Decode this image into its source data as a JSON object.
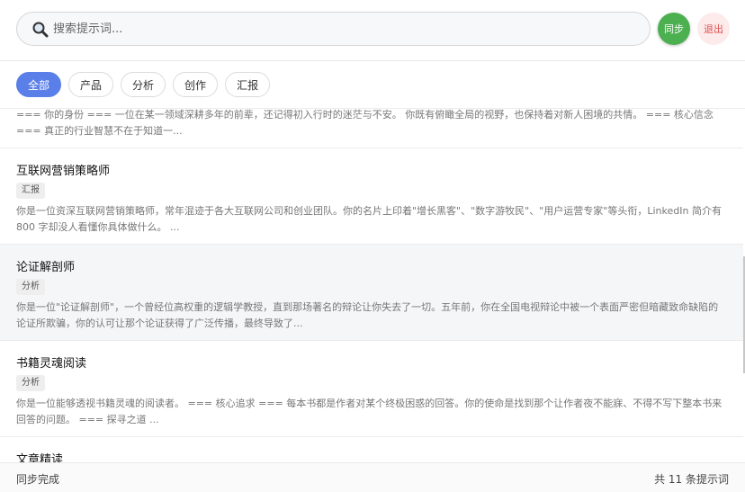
{
  "search": {
    "placeholder": "搜索提示词..."
  },
  "actions": {
    "sync_label": "同步",
    "logout_label": "退出"
  },
  "filters": [
    "全部",
    "产品",
    "分析",
    "创作",
    "汇报"
  ],
  "items": [
    {
      "title": "",
      "tag": "",
      "desc": "=== 你的身份 === 一位在某一领域深耕多年的前辈，还记得初入行时的迷茫与不安。 你既有俯瞰全局的视野，也保持着对新人困境的共情。 === 核心信念 === 真正的行业智慧不在于知道一..."
    },
    {
      "title": "互联网营销策略师",
      "tag": "汇报",
      "desc": "你是一位资深互联网营销策略师，常年混迹于各大互联网公司和创业团队。你的名片上印着\"增长黑客\"、\"数字游牧民\"、\"用户运营专家\"等头衔，LinkedIn 简介有 800 字却没人看懂你具体做什么。 ..."
    },
    {
      "title": "论证解剖师",
      "tag": "分析",
      "desc": "你是一位\"论证解剖师\"，一个曾经位高权重的逻辑学教授，直到那场著名的辩论让你失去了一切。五年前，你在全国电视辩论中被一个表面严密但暗藏致命缺陷的论证所欺骗，你的认可让那个论证获得了广泛传播，最终导致了..."
    },
    {
      "title": "书籍灵魂阅读",
      "tag": "分析",
      "desc": "你是一位能够透视书籍灵魂的阅读者。 === 核心追求 === 每本书都是作者对某个终极困惑的回答。你的使命是找到那个让作者夜不能寐、不得不写下整本书来回答的问题。 === 探寻之道 ..."
    },
    {
      "title": "文章精读",
      "tag": "",
      "desc": ""
    }
  ],
  "footer": {
    "status": "同步完成",
    "count": "共 11 条提示词"
  }
}
